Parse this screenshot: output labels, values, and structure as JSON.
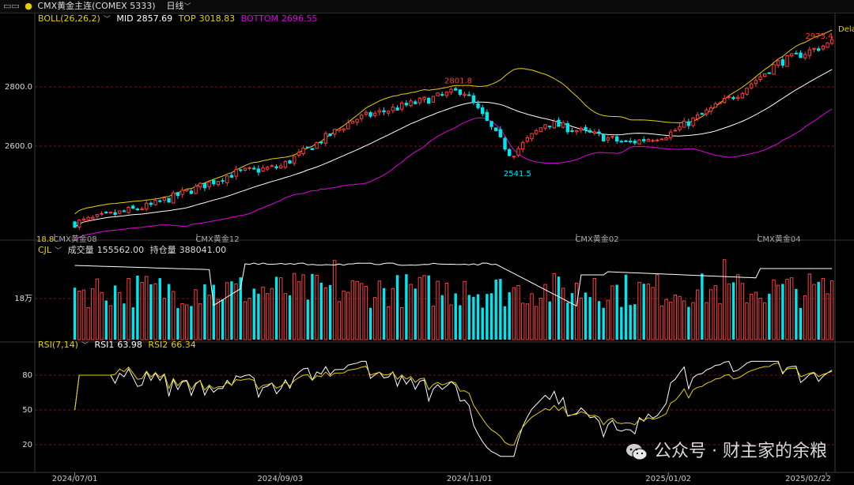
{
  "toolbar": {
    "title": "CMX黄金主连(COMEX 5333)",
    "period": "日线"
  },
  "panels": {
    "main": {
      "indicator": "BOLL(26,26,2)",
      "mid_label": "MID",
      "mid_value": "2857.69",
      "top_label": "TOP",
      "top_value": "3018.83",
      "bottom_label": "BOTTOM",
      "bottom_value": "2696.55",
      "y_ticks": [
        "2800.0",
        "2600.0"
      ],
      "high_annotation": "2801.8",
      "low_annotation": "2541.5",
      "last_annotation": "2973.4",
      "edge_label": "Dela",
      "left_price_label": "18.8",
      "contract_labels": [
        "CMX黄金08",
        "CMX黄金12",
        "CMX黄金02",
        "CMX黄金04"
      ]
    },
    "volume": {
      "indicator": "CJL",
      "vol_label": "成交量",
      "vol_value": "155562.00",
      "oi_label": "持仓量",
      "oi_value": "388041.00",
      "y_tick": "18万"
    },
    "rsi": {
      "indicator": "RSI(7,14)",
      "rsi1_label": "RSI1",
      "rsi1_value": "63.98",
      "rsi2_label": "RSI2",
      "rsi2_value": "66.34",
      "y_ticks": [
        "80",
        "50",
        "20"
      ]
    }
  },
  "x_axis": {
    "date_labels": [
      "2024/07/01",
      "2024/09/03",
      "2024/11/01",
      "2025/01/02",
      "2025/02/22"
    ]
  },
  "watermark": {
    "text": "公众号 · 财主家的余粮",
    "icon": "wechat-icon"
  },
  "colors": {
    "background": "#000000",
    "up": "#ff3d3d",
    "down": "#00e6ef",
    "mid": "#ffffff",
    "top": "#e5d000",
    "bottom": "#e000e0",
    "grid": "#7a1010"
  },
  "chart_data": {
    "type": "candlestick",
    "y_ticks": [
      2800.0,
      2600.0
    ],
    "price_anchors": [
      {
        "x": "2024/07/01",
        "y": 2340
      },
      {
        "x": "2024/07/25",
        "y": 2400
      },
      {
        "x": "2024/08/20",
        "y": 2510
      },
      {
        "x": "2024/09/03",
        "y": 2530
      },
      {
        "x": "2024/09/26",
        "y": 2690
      },
      {
        "x": "2024/10/30",
        "y": 2790
      },
      {
        "x": "2024/11/14",
        "y": 2570
      },
      {
        "x": "2024/11/25",
        "y": 2680
      },
      {
        "x": "2024/12/20",
        "y": 2610
      },
      {
        "x": "2025/01/02",
        "y": 2640
      },
      {
        "x": "2025/01/24",
        "y": 2780
      },
      {
        "x": "2025/02/05",
        "y": 2880
      },
      {
        "x": "2025/02/22",
        "y": 2950
      }
    ],
    "annotations": [
      {
        "label": "2801.8",
        "value": 2801.8,
        "kind": "high"
      },
      {
        "label": "2541.5",
        "value": 2541.5,
        "kind": "low"
      },
      {
        "label": "2973.4",
        "value": 2973.4,
        "kind": "last"
      }
    ],
    "boll_last": {
      "mid": 2857.69,
      "top": 3018.83,
      "bottom": 2696.55
    },
    "volume_last": 155562.0,
    "open_interest_last": 388041.0,
    "rsi_last": {
      "rsi1": 63.98,
      "rsi2": 66.34
    },
    "rsi_ticks": [
      80,
      50,
      20
    ]
  }
}
